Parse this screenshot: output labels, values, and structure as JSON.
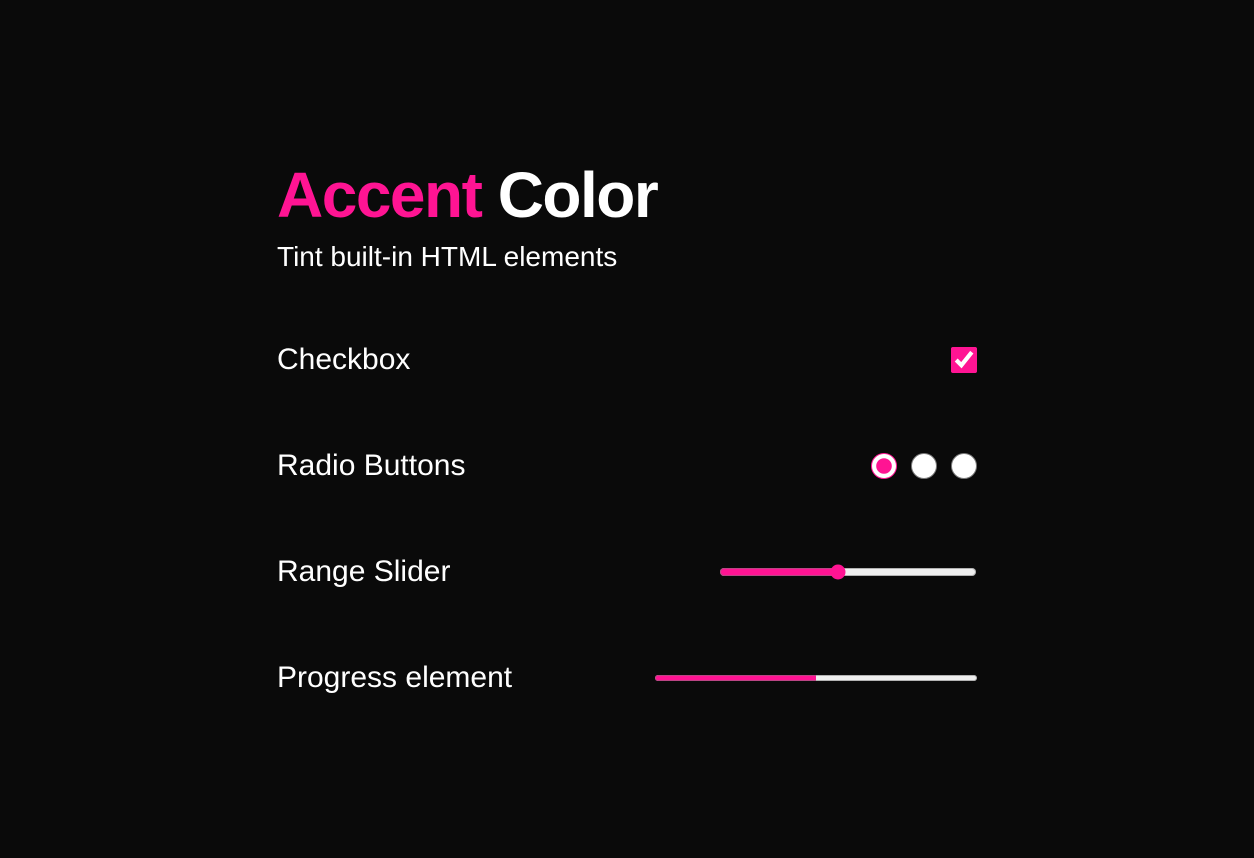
{
  "heading": {
    "accent_word": "Accent",
    "regular_word": "Color"
  },
  "subtitle": "Tint built-in HTML elements",
  "rows": {
    "checkbox": {
      "label": "Checkbox",
      "checked": true
    },
    "radio": {
      "label": "Radio Buttons",
      "selected_index": 0,
      "count": 3
    },
    "range": {
      "label": "Range Slider",
      "value": 46,
      "min": 0,
      "max": 100
    },
    "progress": {
      "label": "Progress element",
      "value": 50,
      "max": 100
    }
  },
  "colors": {
    "accent": "#ff1493",
    "background": "#0a0a0a",
    "text": "#ffffff"
  }
}
